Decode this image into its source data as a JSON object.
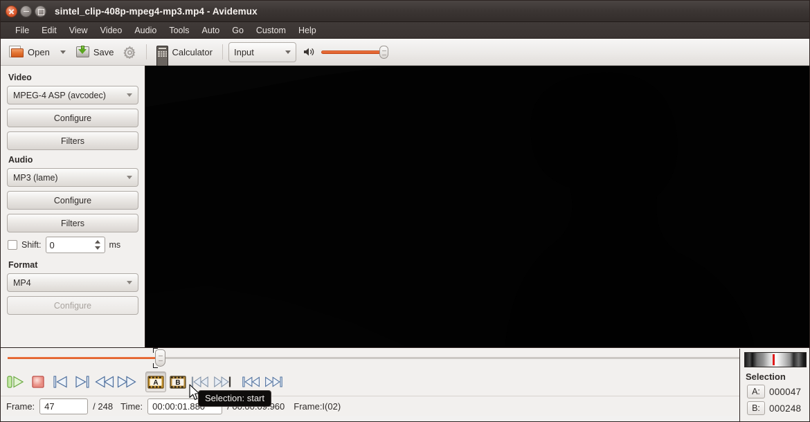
{
  "window": {
    "title": "sintel_clip-408p-mpeg4-mp3.mp4 - Avidemux",
    "buttons": {
      "close": "close-button",
      "minimize": "minimize-button",
      "maximize": "maximize-button"
    }
  },
  "menubar": {
    "items": [
      "File",
      "Edit",
      "View",
      "Video",
      "Audio",
      "Tools",
      "Auto",
      "Go",
      "Custom",
      "Help"
    ]
  },
  "toolbar": {
    "open_label": "Open",
    "save_label": "Save",
    "calculator_label": "Calculator",
    "input_selector": "Input",
    "input_options": [
      "Input",
      "Output"
    ],
    "volume_value": 100
  },
  "sidebar": {
    "video": {
      "title": "Video",
      "codec": "MPEG-4 ASP (avcodec)",
      "configure_label": "Configure",
      "filters_label": "Filters"
    },
    "audio": {
      "title": "Audio",
      "codec": "MP3 (lame)",
      "configure_label": "Configure",
      "filters_label": "Filters",
      "shift_label": "Shift:",
      "shift_value": "0",
      "shift_units": "ms",
      "shift_enabled": false
    },
    "format": {
      "title": "Format",
      "container": "MP4",
      "configure_label": "Configure",
      "configure_enabled": false
    }
  },
  "navigation": {
    "position_percent": 19.2
  },
  "transport": {
    "buttons": [
      {
        "name": "play-button",
        "tooltip": "Play"
      },
      {
        "name": "stop-button",
        "tooltip": "Stop"
      },
      {
        "name": "previous-frame-button",
        "tooltip": "Previous frame"
      },
      {
        "name": "next-frame-button",
        "tooltip": "Next frame"
      },
      {
        "name": "rewind-button",
        "tooltip": "Rewind"
      },
      {
        "name": "forward-button",
        "tooltip": "Forward"
      },
      {
        "name": "selection-start-button",
        "tooltip": "Selection: start"
      },
      {
        "name": "selection-end-button",
        "tooltip": "Selection: end"
      },
      {
        "name": "previous-keyframe-button",
        "tooltip": "Previous keyframe"
      },
      {
        "name": "next-keyframe-button",
        "tooltip": "Next keyframe"
      },
      {
        "name": "go-to-start-button",
        "tooltip": "Go to start"
      },
      {
        "name": "go-to-end-button",
        "tooltip": "Go to end"
      }
    ],
    "marker_a_label": "A",
    "marker_b_label": "B"
  },
  "status": {
    "frame_label": "Frame:",
    "frame_value": "47",
    "frame_total": "/ 248",
    "time_label": "Time:",
    "time_value": "00:00:01.880",
    "time_total": "/ 00:00:09.960",
    "frame_type": "Frame:I(02)"
  },
  "selection": {
    "title": "Selection",
    "a_label": "A:",
    "a_value": "000047",
    "b_label": "B:",
    "b_value": "000248",
    "marker_position_percent": 46
  },
  "tooltip": {
    "text": "Selection: start"
  },
  "colors": {
    "accent_orange": "#dd5a25",
    "titlebar_dark": "#3b3533",
    "panel_bg": "#f2f0ee",
    "video_bg": "#050505",
    "marker_red": "#e01b1b"
  }
}
